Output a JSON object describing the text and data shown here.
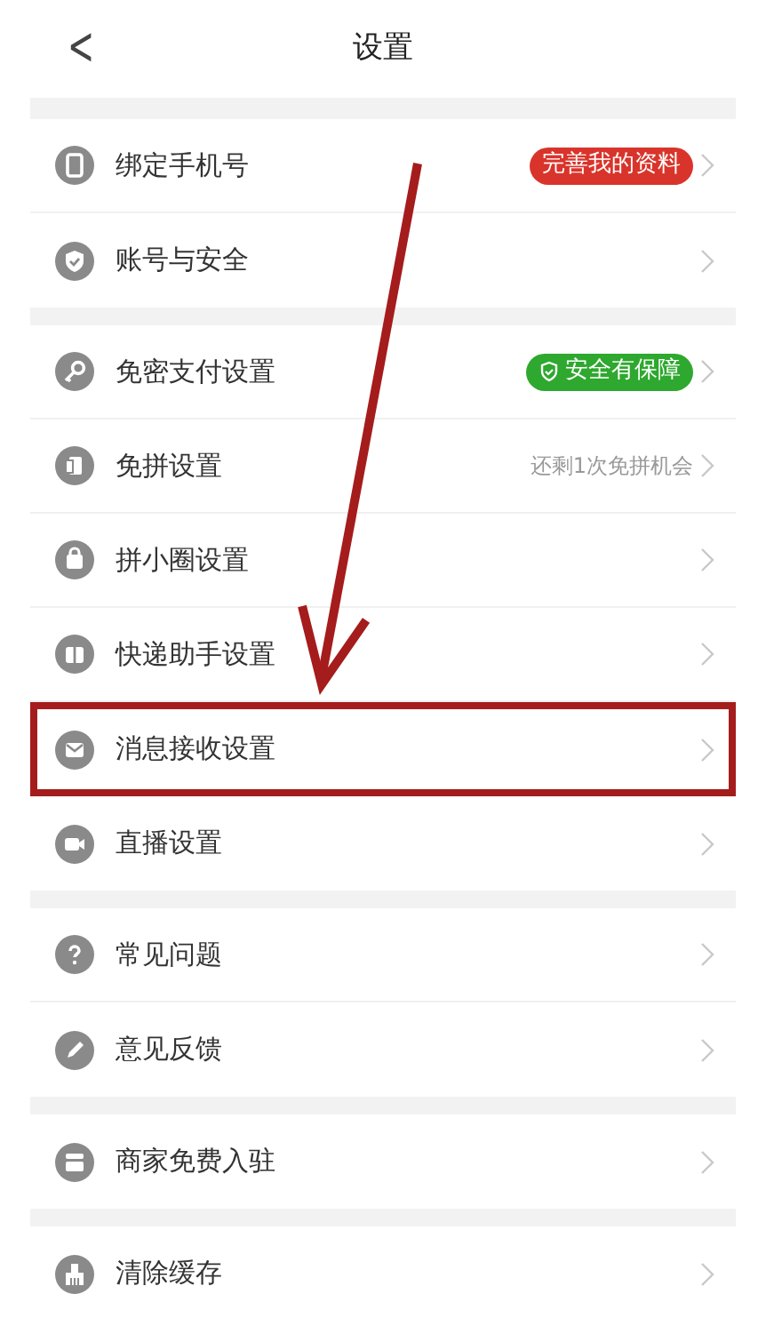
{
  "header": {
    "back": "<",
    "title": "设置"
  },
  "sections": [
    {
      "items": [
        {
          "label": "绑定手机号",
          "badge": {
            "text": "完善我的资料",
            "color": "#d9342b"
          },
          "highlighted": false
        },
        {
          "label": "账号与安全",
          "highlighted": false
        }
      ]
    },
    {
      "items": [
        {
          "label": "免密支付设置",
          "badge": {
            "text": "安全有保障",
            "color": "#2ea82e",
            "shield": true
          },
          "highlighted": false
        },
        {
          "label": "免拼设置",
          "note": "还剩1次免拼机会",
          "highlighted": false
        },
        {
          "label": "拼小圈设置",
          "highlighted": false
        },
        {
          "label": "快递助手设置",
          "highlighted": false
        },
        {
          "label": "消息接收设置",
          "highlighted": true
        },
        {
          "label": "直播设置",
          "highlighted": false
        }
      ]
    },
    {
      "items": [
        {
          "label": "常见问题",
          "highlighted": false
        },
        {
          "label": "意见反馈",
          "highlighted": false
        }
      ]
    },
    {
      "items": [
        {
          "label": "商家免费入驻",
          "highlighted": false
        }
      ]
    },
    {
      "items": [
        {
          "label": "清除缓存",
          "highlighted": false
        }
      ]
    }
  ]
}
